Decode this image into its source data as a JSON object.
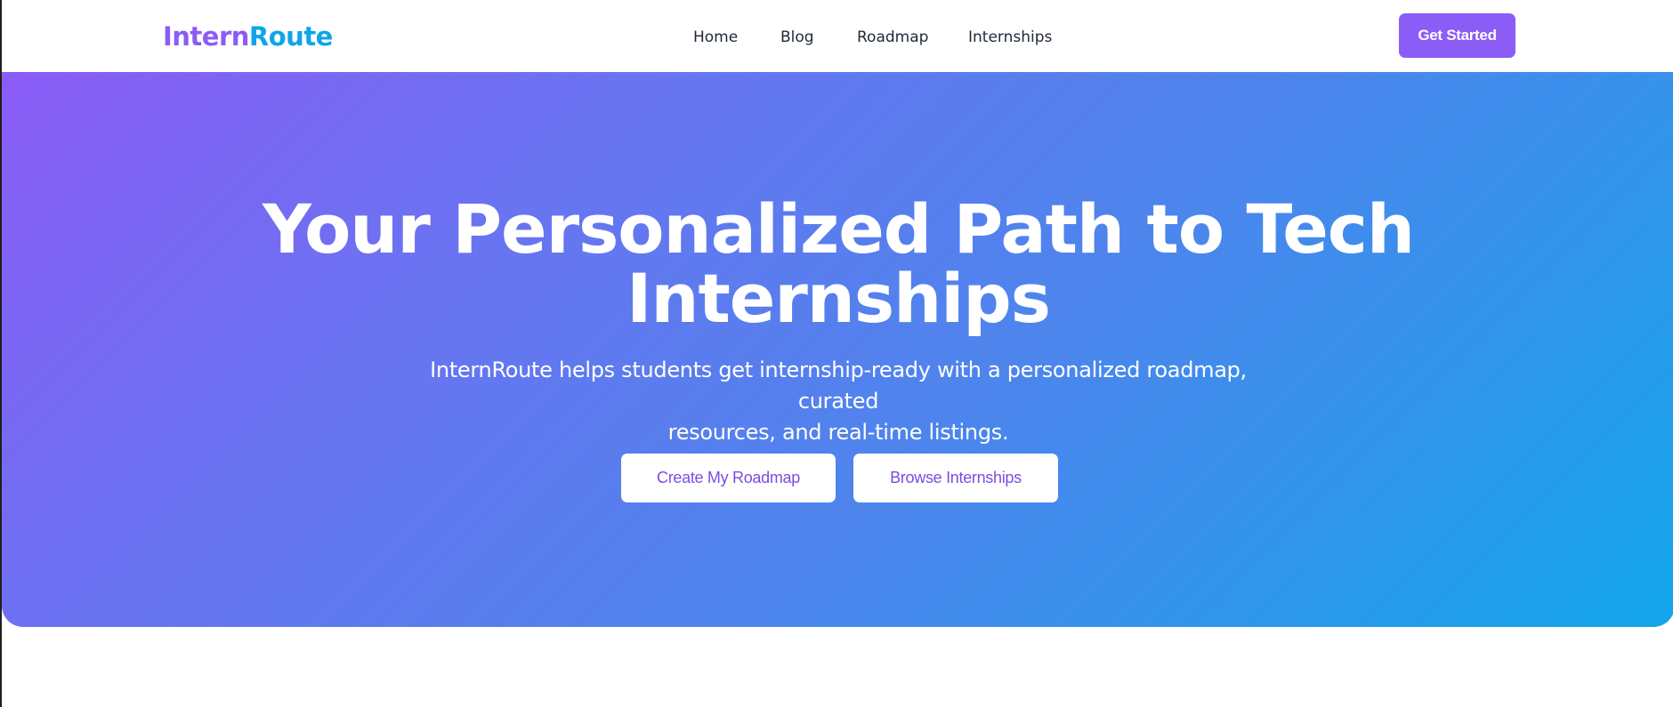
{
  "brand": {
    "name_part1": "Intern",
    "name_part2": "Route",
    "color_primary": "#8b5cf6",
    "color_secondary": "#0ea5e9"
  },
  "nav": {
    "items": [
      {
        "label": "Home"
      },
      {
        "label": "Blog"
      },
      {
        "label": "Roadmap"
      },
      {
        "label": "Internships"
      }
    ],
    "cta_label": "Get Started"
  },
  "hero": {
    "title_line1": "Your Personalized Path to Tech",
    "title_line2": "Internships",
    "subtitle_line1": "InternRoute helps students get internship-ready with a personalized roadmap, curated",
    "subtitle_line2": "resources, and real-time listings.",
    "primary_button": "Create My Roadmap",
    "secondary_button": "Browse Internships",
    "gradient_start": "#8b5cf6",
    "gradient_end": "#0ea5e9"
  }
}
